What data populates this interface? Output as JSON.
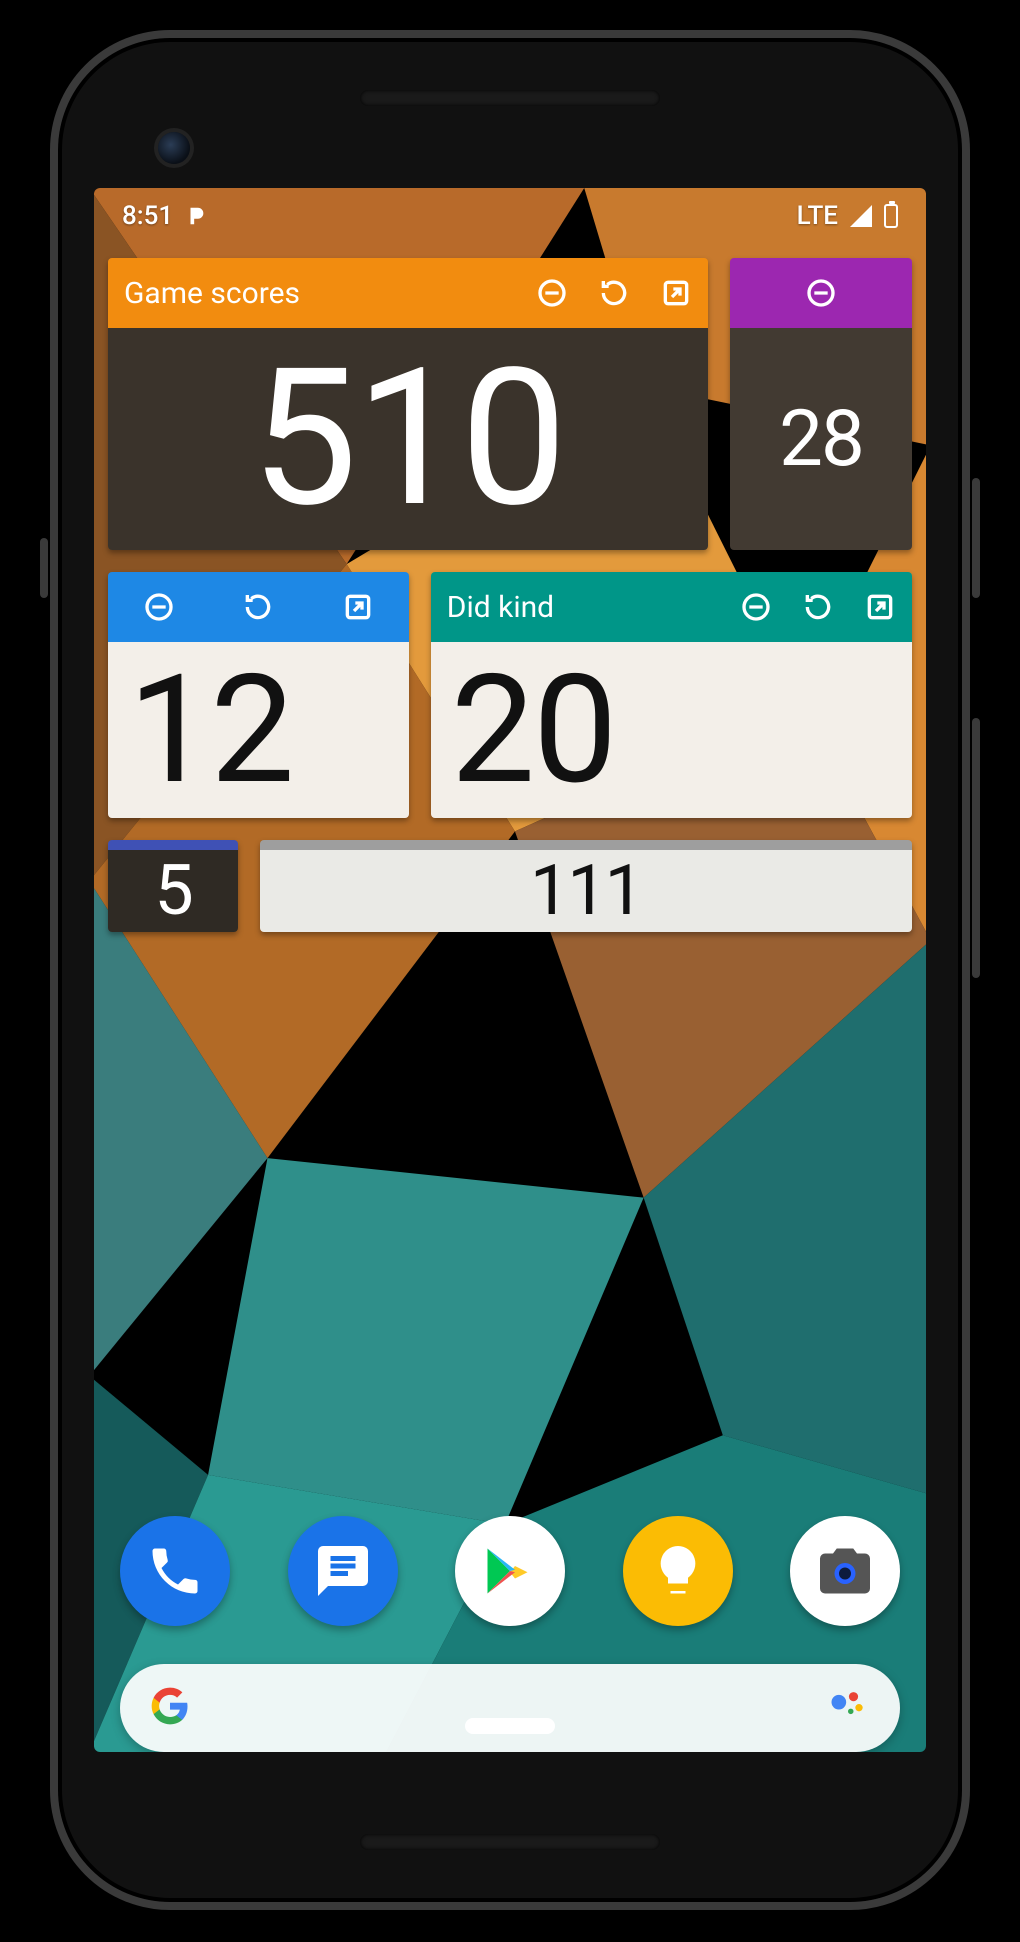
{
  "statusbar": {
    "time": "8:51",
    "network": "LTE"
  },
  "widgets": {
    "row1": [
      {
        "title": "Game scores",
        "value": "510",
        "header_color": "#f28c0f"
      },
      {
        "title": "",
        "value": "28",
        "header_color": "#9c27b0"
      }
    ],
    "row2": [
      {
        "title": "",
        "value": "12",
        "header_color": "#1e88e5"
      },
      {
        "title": "Did kind",
        "value": "20",
        "header_color": "#009688"
      }
    ],
    "row3": [
      {
        "title": "",
        "value": "5",
        "header_color": "#3f51b5"
      },
      {
        "title": "",
        "value": "111",
        "header_color": "#9e9e9e"
      }
    ]
  },
  "dock": [
    "phone",
    "messages",
    "play-store",
    "keep",
    "camera"
  ],
  "colors": {
    "orange": "#f28c0f",
    "purple": "#9c27b0",
    "blue": "#1e88e5",
    "teal": "#009688",
    "indigo": "#3f51b5",
    "grey": "#9e9e9e"
  }
}
